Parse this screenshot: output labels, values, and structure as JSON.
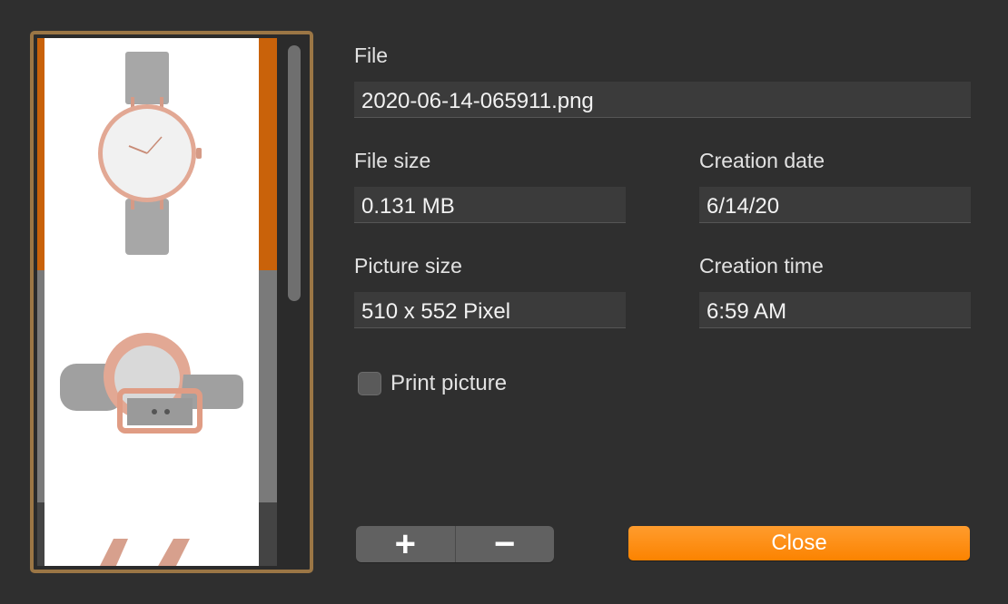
{
  "fields": {
    "file": {
      "label": "File",
      "value": "2020-06-14-065911.png"
    },
    "file_size": {
      "label": "File size",
      "value": "0.131 MB"
    },
    "creation_date": {
      "label": "Creation date",
      "value": "6/14/20"
    },
    "picture_size": {
      "label": "Picture size",
      "value": "510 x 552 Pixel"
    },
    "creation_time": {
      "label": "Creation time",
      "value": "6:59 AM"
    }
  },
  "print_picture": {
    "label": "Print picture",
    "checked": false
  },
  "buttons": {
    "add": "+",
    "remove": "−",
    "close": "Close"
  },
  "thumbnails": [
    {
      "icon": "watch-front-icon",
      "selected": true
    },
    {
      "icon": "watch-back-icon",
      "selected": false
    },
    {
      "icon": "watch-strap-icon",
      "selected": false
    }
  ],
  "colors": {
    "accent": "#fb8300",
    "selection_border": "#c9620a",
    "frame": "#9b7645",
    "background": "#2f2f2f"
  }
}
